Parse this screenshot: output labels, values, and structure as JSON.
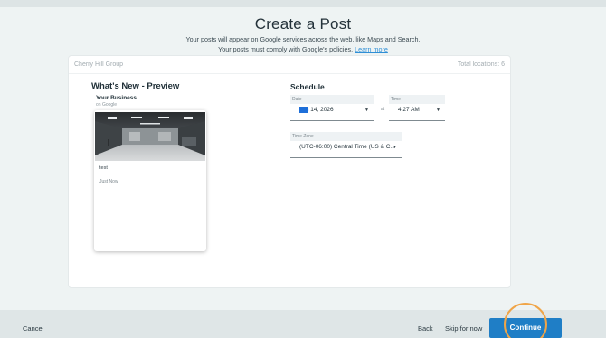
{
  "header": {
    "title": "Create a Post",
    "subtitle_line1": "Your posts will appear on Google services across the web, like Maps and Search.",
    "subtitle_line2_prefix": "Your posts must comply with Google's policies.",
    "learn_more": "Learn more"
  },
  "card": {
    "group_name": "Cherry Hill Group",
    "total_locations": "Total locations: 6"
  },
  "preview": {
    "title": "What's New - Preview",
    "business_name": "Your Business",
    "on_google": "on Google",
    "post_text": "test",
    "post_time": "Just Now"
  },
  "schedule": {
    "title": "Schedule",
    "date_label": "Date",
    "date_month_highlight": "Jun",
    "date_rest": " 14, 2026",
    "at_label": "at",
    "time_label": "Time",
    "time_value": "4:27  AM",
    "timezone_label": "Time Zone",
    "timezone_value": "(UTC-06:00) Central Time (US & C..."
  },
  "footer": {
    "cancel": "Cancel",
    "back": "Back",
    "skip": "Skip for now",
    "continue": "Continue"
  },
  "icons": {
    "caret": "chevron-down-icon"
  }
}
